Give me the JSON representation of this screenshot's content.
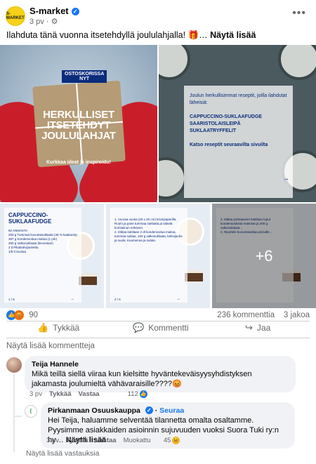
{
  "post": {
    "page_name": "S-market",
    "avatar_text": "S-MARKET",
    "time": "3 pv",
    "caption_text": "Ilahduta tänä vuonna itsetehdyllä joululahjalla! 🎁…",
    "see_more": "Näytä lisää"
  },
  "images": {
    "first": {
      "label_top": "OSTOSKORISSA",
      "label_bottom": "NYT",
      "headline": "HERKULLISET ITSETEHDYT JOULULAHJAT",
      "subhead": "Kurkkaa ideat ja inspiroidu!"
    },
    "second": {
      "intro": "Joulun herkullisimmat reseptit, joilla ilahdutat läheisiä:",
      "recipes": "CAPPUCCINO-SUKLAAFUDGE SAARISTOLAISLEIPÄ SUKLAATRYFFELIT",
      "footer": "Katso reseptit seuraavilta sivuilta",
      "arrow": "→"
    },
    "card1": {
      "title": "CAPPUCCINO-SUKLAAFUDGE",
      "body": "60 ANNOSTA\n200 g Tummaa kuvuntasuklaata (46 % kaakaota)\n397 g Kondensoitua maitoa (1 prk)\n300 g Valkosuklaata (kivontaan)\n2 tl Pikakahvijauhetta\n1/8 tl Suolaa",
      "page": "1 / 6",
      "arrow": "→"
    },
    "card2": {
      "body": "1. Vuoraa vuoka (20 x 20 cm) leivinpaperilla. Rouhi ja pane tummaa suklaata ja säästä koristeluun erikseen.\n2. Mittaa kattilaan 2 dl kondensoitua maitoa, tummaa suklaa, 100 g valkosuklaata, kahvijauhe ja suola. Kuumenna ja sulata.",
      "page": "2 / 6",
      "arrow": "→"
    },
    "card3": {
      "body": "3. Mittaa puhtaaseen kattilaan loput kondensoidusta maitosta ja 200 g valkosuklaata...\n4. Ripottele kuvuntasuklaa pinnalle...",
      "more": "+6"
    }
  },
  "reactions": {
    "like_icon": "like-icon",
    "angry_icon": "angry-icon",
    "count": "90",
    "comments": "236 kommenttia",
    "shares": "3 jakoa"
  },
  "actions": {
    "like": "Tykkää",
    "comment": "Kommentti",
    "share": "Jaa"
  },
  "see_more_comments": "Näytä lisää kommentteja",
  "comments": [
    {
      "name": "Teija Hannele",
      "text": "Mikä teillä siellä viiraa kun kielsitte hyväntekeväisyysyhdistyksen jakamasta joulumieltä vähävaraisille????😡",
      "time": "3 pv",
      "like_action": "Tykkää",
      "reply_action": "Vastaa",
      "like_count": "112"
    },
    {
      "name": "Pirkanmaan Osuuskauppa",
      "follow": "Seuraa",
      "text": "Hei Teija, haluamme selventää tilannetta omalta osaltamme. Pyysimme asiakkaiden asioinnin sujuvuuden vuoksi Suora Tuki ry:n hy…",
      "see_more": "Näytä lisää",
      "time": "3 pv",
      "like_action": "Tykkää",
      "reply_action": "Vastaa",
      "edited": "Muokattu",
      "like_count": "45"
    }
  ],
  "see_more_replies": "Näytä lisää vastauksia"
}
